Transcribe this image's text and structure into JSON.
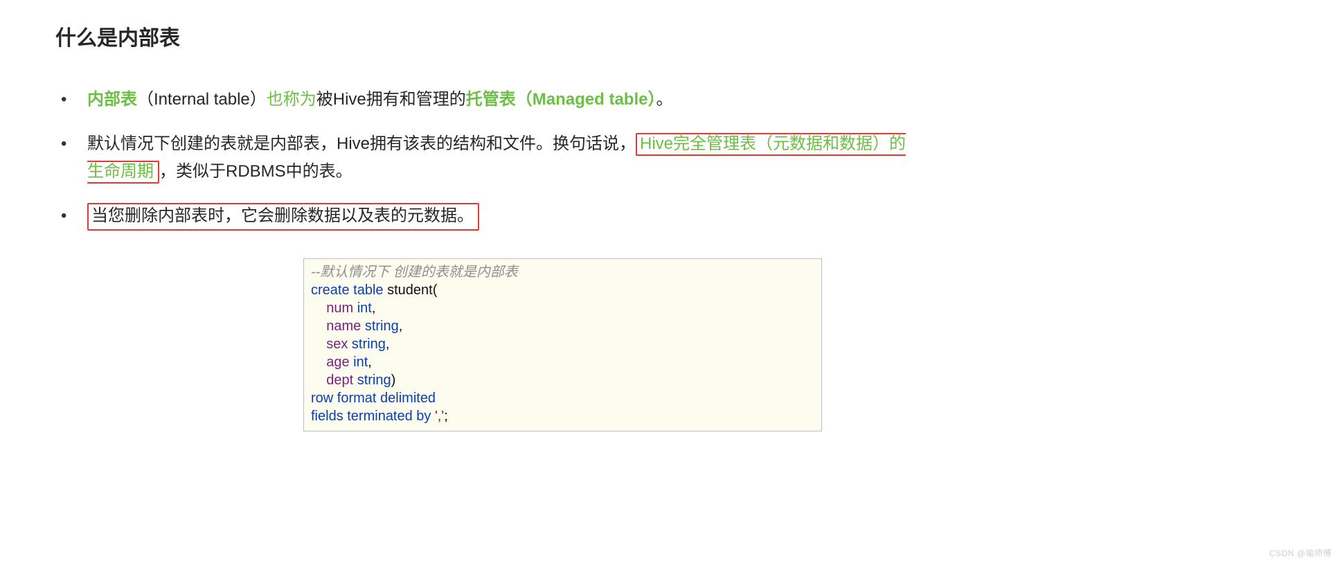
{
  "heading": "什么是内部表",
  "bullets": {
    "b1": {
      "seg1": "内部表",
      "seg2": "（Internal table）",
      "seg3": "也称为",
      "seg4": "被Hive拥有和管理的",
      "seg5": "托管表（Managed table）",
      "seg6": "。"
    },
    "b2": {
      "pre": "默认情况下创建的表就是内部表，Hive拥有该表的结构和文件。换句话说，",
      "hl_line1": "Hive完全管理表（元数据和数据）的",
      "hl_line2": "生命周期",
      "post": "，类似于RDBMS中的表。"
    },
    "b3": {
      "boxed": "当您删除内部表时，它会删除数据以及表的元数据。"
    }
  },
  "code": {
    "comment": "--默认情况下 创建的表就是内部表",
    "kw_create": "create ",
    "kw_table": "table ",
    "tbl_name": "student",
    "open_paren": "(",
    "fields": [
      {
        "indent": "    ",
        "name": "num ",
        "type": "int",
        "trail": ","
      },
      {
        "indent": "    ",
        "name": "name ",
        "type": "string",
        "trail": ","
      },
      {
        "indent": "    ",
        "name": "sex ",
        "type": "string",
        "trail": ","
      },
      {
        "indent": "    ",
        "name": "age ",
        "type": "int",
        "trail": ","
      },
      {
        "indent": "    ",
        "name": "dept ",
        "type": "string",
        "trail": ")"
      }
    ],
    "row_fmt": "row format delimited",
    "fields_term_pre": "fields terminated by ",
    "fields_term_str": "','",
    "semicolon": ";"
  },
  "watermark": "CSDN @喻师傅"
}
